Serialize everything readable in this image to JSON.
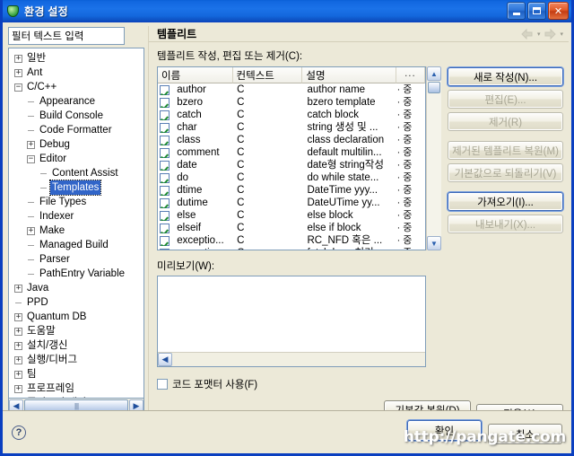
{
  "window": {
    "title": "환경 설정",
    "icon": "shield-icon",
    "controls": {
      "minimize": "_",
      "maximize": "□",
      "close": "✕"
    }
  },
  "sidebar": {
    "filter_placeholder": "필터 텍스트 입력",
    "filter_value": "",
    "tree": [
      {
        "label": "일반",
        "level": 0,
        "state": "collapsed"
      },
      {
        "label": "Ant",
        "level": 0,
        "state": "collapsed"
      },
      {
        "label": "C/C++",
        "level": 0,
        "state": "expanded"
      },
      {
        "label": "Appearance",
        "level": 1,
        "state": "leaf"
      },
      {
        "label": "Build Console",
        "level": 1,
        "state": "leaf"
      },
      {
        "label": "Code Formatter",
        "level": 1,
        "state": "leaf"
      },
      {
        "label": "Debug",
        "level": 1,
        "state": "collapsed"
      },
      {
        "label": "Editor",
        "level": 1,
        "state": "expanded"
      },
      {
        "label": "Content Assist",
        "level": 2,
        "state": "leaf"
      },
      {
        "label": "Templates",
        "level": 2,
        "state": "leaf",
        "selected": true
      },
      {
        "label": "File Types",
        "level": 1,
        "state": "leaf"
      },
      {
        "label": "Indexer",
        "level": 1,
        "state": "leaf"
      },
      {
        "label": "Make",
        "level": 1,
        "state": "collapsed"
      },
      {
        "label": "Managed Build",
        "level": 1,
        "state": "leaf"
      },
      {
        "label": "Parser",
        "level": 1,
        "state": "leaf"
      },
      {
        "label": "PathEntry Variable",
        "level": 1,
        "state": "leaf"
      },
      {
        "label": "Java",
        "level": 0,
        "state": "collapsed"
      },
      {
        "label": "PPD",
        "level": 0,
        "state": "leaf"
      },
      {
        "label": "Quantum DB",
        "level": 0,
        "state": "collapsed"
      },
      {
        "label": "도움말",
        "level": 0,
        "state": "collapsed"
      },
      {
        "label": "설치/갱신",
        "level": 0,
        "state": "collapsed"
      },
      {
        "label": "실행/디버그",
        "level": 0,
        "state": "collapsed"
      },
      {
        "label": "팀",
        "level": 0,
        "state": "collapsed"
      },
      {
        "label": "프로프레임",
        "level": 0,
        "state": "collapsed"
      },
      {
        "label": "플러그인 개발",
        "level": 0,
        "state": "collapsed"
      }
    ],
    "hscroll": {
      "left": "◀",
      "right": "▶",
      "grip": "||||"
    }
  },
  "page": {
    "title": "템플리트",
    "nav": {
      "back": "back-arrow",
      "forward": "forward-arrow",
      "caret": "▾"
    },
    "section_label": "템플리트 작성, 편집 또는 제거(C):",
    "table": {
      "columns": [
        "이름",
        "컨텍스트",
        "설명",
        "..."
      ],
      "rows": [
        {
          "checked": true,
          "name": "author",
          "context": "C",
          "desc": "author name",
          "more": "· 중"
        },
        {
          "checked": true,
          "name": "bzero",
          "context": "C",
          "desc": "bzero template",
          "more": "· 중"
        },
        {
          "checked": true,
          "name": "catch",
          "context": "C",
          "desc": "catch block",
          "more": "· 중"
        },
        {
          "checked": true,
          "name": "char",
          "context": "C",
          "desc": "string 생성 및 ...",
          "more": "· 중"
        },
        {
          "checked": true,
          "name": "class",
          "context": "C",
          "desc": "class declaration",
          "more": "· 중"
        },
        {
          "checked": true,
          "name": "comment",
          "context": "C",
          "desc": "default multilin...",
          "more": "· 중"
        },
        {
          "checked": true,
          "name": "date",
          "context": "C",
          "desc": "date형 string작성",
          "more": "· 중"
        },
        {
          "checked": true,
          "name": "do",
          "context": "C",
          "desc": "do while state...",
          "more": "· 중"
        },
        {
          "checked": true,
          "name": "dtime",
          "context": "C",
          "desc": "DateTime yyy...",
          "more": "· 중"
        },
        {
          "checked": true,
          "name": "dutime",
          "context": "C",
          "desc": "DateUTime yy...",
          "more": "· 중"
        },
        {
          "checked": true,
          "name": "else",
          "context": "C",
          "desc": "else block",
          "more": "· 중"
        },
        {
          "checked": true,
          "name": "elseif",
          "context": "C",
          "desc": "else if block",
          "more": "· 중"
        },
        {
          "checked": true,
          "name": "exceptio...",
          "context": "C",
          "desc": "RC_NFD 혹은 ...",
          "more": "· 중"
        },
        {
          "checked": true,
          "name": "exceptio...",
          "context": "C",
          "desc": "fetch loop 처리...",
          "more": "· 중"
        }
      ],
      "scroll": {
        "up": "▲",
        "down": "▼"
      }
    },
    "buttons": {
      "new": "새로 작성(N)...",
      "edit": "편집(E)...",
      "remove": "제거(R)",
      "restore_removed": "제거된 템플리트 복원(M)",
      "revert_to_default": "기본값으로 되돌리기(V)",
      "import": "가져오기(I)...",
      "export": "내보내기(X)..."
    },
    "preview_label": "미리보기(W):",
    "preview_value": "",
    "use_code_formatter": {
      "label": "코드 포맷터 사용(F)",
      "checked": false
    },
    "restore_defaults": "기본값 복원(D)",
    "apply": "적용(A)"
  },
  "footer": {
    "help_icon": "?",
    "ok": "확인",
    "cancel": "취소",
    "watermark": "http://pangate.com"
  }
}
